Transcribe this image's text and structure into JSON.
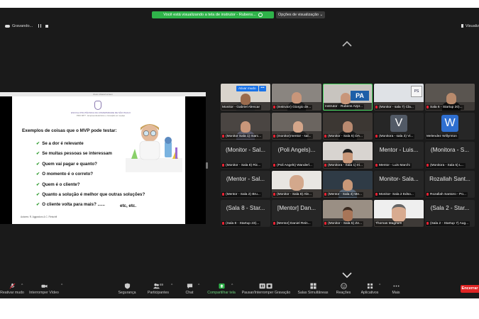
{
  "top": {
    "banner": "Você está visualizando a tela de instrutor - Rubens...",
    "view_options": "Opções de visualização",
    "recording": "Gravando...",
    "view": "Visualiz"
  },
  "shared_slide": {
    "window_title": "Zoom shared screen",
    "school": "ESCOLA POLITÉCNICA DA UNIVERSIDADE DE SÃO PAULO",
    "course": "PRO 3877 - Empreendedorismo e Inovação em equipe",
    "title": "Exemplos de coisas que o MVP pode testar:",
    "bullets": [
      "Se a dor é relevante",
      "Se muitas pessoas se interessam",
      "Quem vai pagar e quanto?",
      "O momento é o correto?",
      "Quem é o  cliente?",
      "Quanto a solução é melhor que outras soluções?",
      "O cliente volta para mais? ......"
    ],
    "etc": "etc, etc.",
    "authors": "Autores: R. Aggradoro & C. Fleischfi"
  },
  "tiles": [
    {
      "name": "Monitor - Gabriel Alencar",
      "admit": "Ativar mudo",
      "more": "•••"
    },
    {
      "name": "(Instrutor) Giorgio de..."
    },
    {
      "name": "Instrutor - Rubens Azpr..."
    },
    {
      "name": "(Monitor - sala 7) Cla..."
    },
    {
      "name": "Sala 6 - Startup 20)..."
    },
    {
      "name": "(Monitor Sala 1) marc..."
    },
    {
      "name": "(monitor)mentor - sal..."
    },
    {
      "name": "(Monitor - Sala 6) DA..."
    },
    {
      "name": "(Monitora - sala 3) Vi...",
      "avatar": "V"
    },
    {
      "name": "Melendez Willymton",
      "avatar": "W"
    },
    {
      "name": "(Monitor - Sala 8) Ric...",
      "big": "(Monitor - Sal..."
    },
    {
      "name": "(Poli Angels) Wanderl...",
      "big": "(Poli Angels)..."
    },
    {
      "name": "(Monitora - Sala 1) Iri..."
    },
    {
      "name": "Mentor - Luis Marchi",
      "big": "Mentor - Luis..."
    },
    {
      "name": "(Monitora - Sala 5) L...",
      "big": "(Monitora - S..."
    },
    {
      "name": "(Mentor - Sala 2) Bru...",
      "big": "(Mentor - Sal..."
    },
    {
      "name": "(Monitor - Sala 8) Ale..."
    },
    {
      "name": "(Mentor - Sala 4) Me..."
    },
    {
      "name": "Monitor- Sala 2 Edso...",
      "big": "Monitor- Sala..."
    },
    {
      "name": "Rozallah Santoro - Po...",
      "big": "Rozallah Sant..."
    },
    {
      "name": "(Sala 8 - Startup 23)...",
      "big": "(Sala 8 - Star..."
    },
    {
      "name": "[Mentor] Daniel Rein...",
      "big": "[Mentor] Dan..."
    },
    {
      "name": "(Monitor - Sala 5) Ze..."
    },
    {
      "name": "Thomas Magnum"
    },
    {
      "name": "(Sala 2 - Startup 7) Aug...",
      "big": "(Sala 2 - Star..."
    }
  ],
  "toolbar": {
    "mute": "Reativar mudo",
    "video": "Interromper Vídeo",
    "security": "Segurança",
    "participants": "Participantes",
    "participants_count": "69",
    "chat": "Chat",
    "share": "Compartilhar tela",
    "record": "Pausar/Interromper Gravação",
    "rooms": "Salas Simultâneas",
    "reactions": "Reações",
    "apps": "Aplicativos",
    "more": "Mais",
    "end": "Encerrar"
  },
  "colors": {
    "banner_green": "#2fb34a",
    "share_green": "#2fb34a",
    "end_red": "#e02424",
    "active_border": "#4cd964",
    "mute_red": "#e23333"
  }
}
